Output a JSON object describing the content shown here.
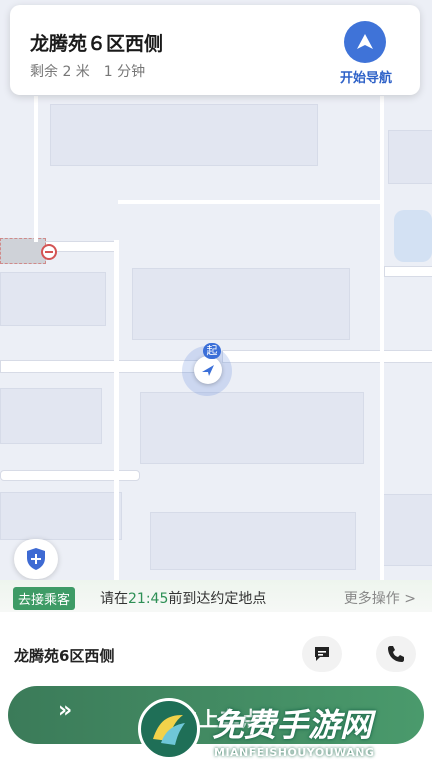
{
  "nav_card": {
    "destination": "龙腾苑６区西侧",
    "remaining": "剩余 2 米　1 分钟",
    "start_nav_label": "开始导航"
  },
  "map": {
    "start_marker": "起"
  },
  "status": {
    "pickup_badge": "去接乘客",
    "instruction_prefix": "请在",
    "instruction_time": "21:45",
    "instruction_suffix": "前到达约定地点",
    "more_actions": "更多操作 >"
  },
  "destination_row": {
    "label": "龙腾苑6区西侧"
  },
  "slide_button": {
    "arrows": "»",
    "label": "去上车点"
  },
  "watermark": {
    "title": "免费手游网",
    "subtitle": "MIANFEISHOUYOUWANG"
  },
  "colors": {
    "accent_blue": "#3f73d8",
    "accent_green": "#3e9b66"
  }
}
